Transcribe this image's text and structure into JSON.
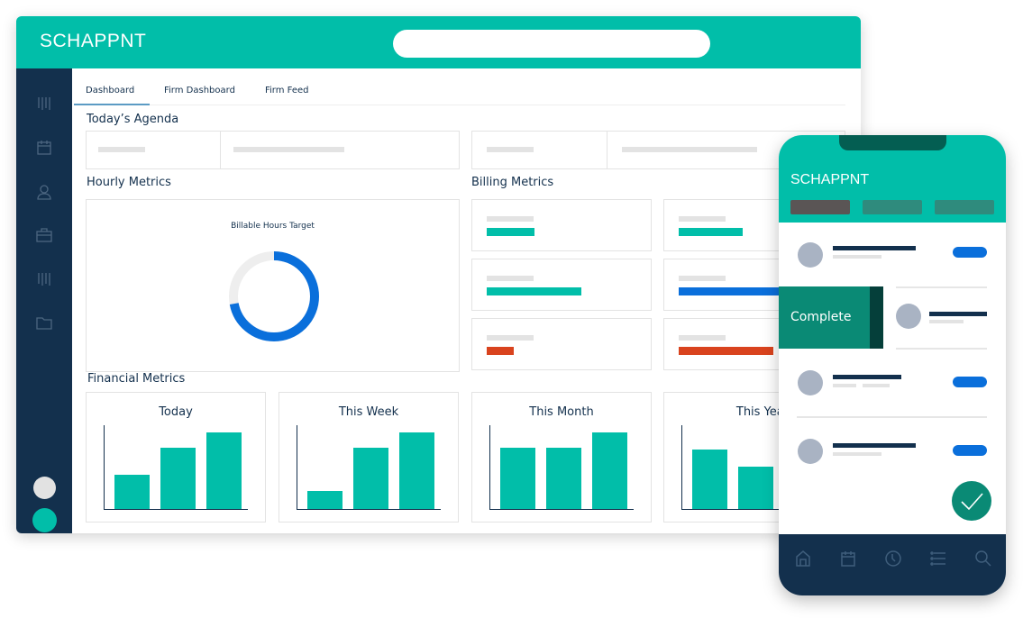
{
  "app": {
    "title": "SCHAPPNT",
    "search_placeholder": ""
  },
  "tabs": [
    {
      "label": "Dashboard",
      "active": true
    },
    {
      "label": "Firm Dashboard"
    },
    {
      "label": "Firm Feed"
    }
  ],
  "sidebar": {
    "icons": [
      "barcode-icon",
      "calendar-icon",
      "user-icon",
      "briefcase-icon",
      "barcode-icon",
      "folder-icon"
    ]
  },
  "sections": {
    "agenda": "Today’s Agenda",
    "hourly": "Hourly Metrics",
    "billing": "Billing Metrics",
    "financial": "Financial Metrics"
  },
  "hourly": {
    "chart_title": "Billable Hours Target",
    "progress": 0.72,
    "colors": {
      "fill": "#0A6FDB",
      "track": "#EEEEEE"
    }
  },
  "billing": {
    "bars": [
      {
        "fraction": 0.35,
        "color": "#01BEA9"
      },
      {
        "fraction": 0.47,
        "color": "#01BEA9"
      },
      {
        "fraction": 0.7,
        "color": "#01BEA9"
      },
      {
        "fraction": 0.75,
        "color": "#0A6FDB"
      },
      {
        "fraction": 0.2,
        "color": "#D9431E"
      },
      {
        "fraction": 0.7,
        "color": "#D9431E"
      }
    ]
  },
  "chart_data": [
    {
      "type": "bar",
      "title": "Today",
      "values": [
        45,
        80,
        100
      ]
    },
    {
      "type": "bar",
      "title": "This Week",
      "values": [
        23,
        80,
        100
      ]
    },
    {
      "type": "bar",
      "title": "This Month",
      "values": [
        80,
        80,
        100
      ]
    },
    {
      "type": "bar",
      "title": "This Year",
      "values": [
        78,
        55
      ]
    }
  ],
  "phone": {
    "title": "SCHAPPNT",
    "swipe_action": "Complete",
    "colors": {
      "header": "#01BEA9",
      "action": "#0A8A75"
    },
    "nav": [
      "home-icon",
      "calendar-icon",
      "clock-icon",
      "list-icon",
      "search-icon"
    ]
  }
}
